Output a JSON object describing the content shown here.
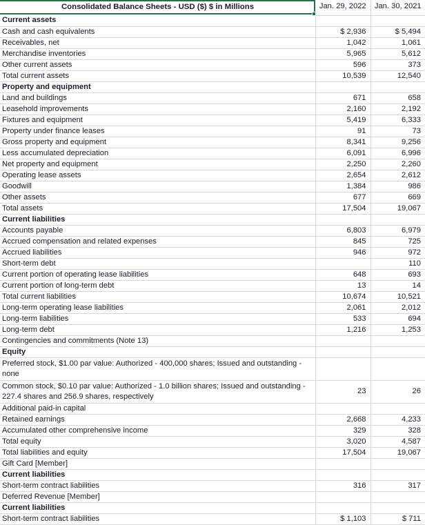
{
  "sheet": {
    "title": "Consolidated Balance Sheets - USD ($) $ in Millions",
    "columns": [
      "Jan. 29, 2022",
      "Jan. 30, 2021"
    ],
    "accent_color": "#217346",
    "gridline_color": "#d9d9d9",
    "text_color": "#1b1b2f"
  },
  "rows": [
    {
      "label": "Current assets",
      "bold": true,
      "tall": false,
      "v1": "",
      "v2": ""
    },
    {
      "label": "Cash and cash equivalents",
      "bold": false,
      "tall": false,
      "v1": "$ 2,936",
      "v2": "$ 5,494"
    },
    {
      "label": "Receivables, net",
      "bold": false,
      "tall": false,
      "v1": "1,042",
      "v2": "1,061"
    },
    {
      "label": "Merchandise inventories",
      "bold": false,
      "tall": false,
      "v1": "5,965",
      "v2": "5,612"
    },
    {
      "label": "Other current assets",
      "bold": false,
      "tall": false,
      "v1": "596",
      "v2": "373"
    },
    {
      "label": "Total current assets",
      "bold": false,
      "tall": false,
      "v1": "10,539",
      "v2": "12,540"
    },
    {
      "label": "Property and equipment",
      "bold": true,
      "tall": false,
      "v1": "",
      "v2": ""
    },
    {
      "label": "Land and buildings",
      "bold": false,
      "tall": false,
      "v1": "671",
      "v2": "658"
    },
    {
      "label": "Leasehold improvements",
      "bold": false,
      "tall": false,
      "v1": "2,160",
      "v2": "2,192"
    },
    {
      "label": "Fixtures and equipment",
      "bold": false,
      "tall": false,
      "v1": "5,419",
      "v2": "6,333"
    },
    {
      "label": "Property under finance leases",
      "bold": false,
      "tall": false,
      "v1": "91",
      "v2": "73"
    },
    {
      "label": "Gross property and equipment",
      "bold": false,
      "tall": false,
      "v1": "8,341",
      "v2": "9,256"
    },
    {
      "label": "Less accumulated depreciation",
      "bold": false,
      "tall": false,
      "v1": "6,091",
      "v2": "6,996"
    },
    {
      "label": "Net property and equipment",
      "bold": false,
      "tall": false,
      "v1": "2,250",
      "v2": "2,260"
    },
    {
      "label": "Operating lease assets",
      "bold": false,
      "tall": false,
      "v1": "2,654",
      "v2": "2,612"
    },
    {
      "label": "Goodwill",
      "bold": false,
      "tall": false,
      "v1": "1,384",
      "v2": "986"
    },
    {
      "label": "Other assets",
      "bold": false,
      "tall": false,
      "v1": "677",
      "v2": "669"
    },
    {
      "label": "Total assets",
      "bold": false,
      "tall": false,
      "v1": "17,504",
      "v2": "19,067"
    },
    {
      "label": "Current liabilities",
      "bold": true,
      "tall": false,
      "v1": "",
      "v2": ""
    },
    {
      "label": "Accounts payable",
      "bold": false,
      "tall": false,
      "v1": "6,803",
      "v2": "6,979"
    },
    {
      "label": "Accrued compensation and related expenses",
      "bold": false,
      "tall": false,
      "v1": "845",
      "v2": "725"
    },
    {
      "label": "Accrued liabilities",
      "bold": false,
      "tall": false,
      "v1": "946",
      "v2": "972"
    },
    {
      "label": "Short-term debt",
      "bold": false,
      "tall": false,
      "v1": "",
      "v2": "110"
    },
    {
      "label": "Current portion of operating lease liabilities",
      "bold": false,
      "tall": false,
      "v1": "648",
      "v2": "693"
    },
    {
      "label": "Current portion of long-term debt",
      "bold": false,
      "tall": false,
      "v1": "13",
      "v2": "14"
    },
    {
      "label": "Total current liabilities",
      "bold": false,
      "tall": false,
      "v1": "10,674",
      "v2": "10,521"
    },
    {
      "label": "Long-term operating lease liabilities",
      "bold": false,
      "tall": false,
      "v1": "2,061",
      "v2": "2,012"
    },
    {
      "label": "Long-term liabilities",
      "bold": false,
      "tall": false,
      "v1": "533",
      "v2": "694"
    },
    {
      "label": "Long-term debt",
      "bold": false,
      "tall": false,
      "v1": "1,216",
      "v2": "1,253"
    },
    {
      "label": "Contingencies and commitments (Note 13)",
      "bold": false,
      "tall": false,
      "v1": "",
      "v2": ""
    },
    {
      "label": "Equity",
      "bold": true,
      "tall": false,
      "v1": "",
      "v2": ""
    },
    {
      "label": "Preferred stock, $1.00 par value: Authorized - 400,000 shares; Issued and outstanding - none",
      "bold": false,
      "tall": true,
      "v1": "",
      "v2": ""
    },
    {
      "label": "Common stock, $0.10 par value: Authorized - 1.0 billion shares; Issued and outstanding - 227.4 shares and 256.9 shares, respectively",
      "bold": false,
      "tall": true,
      "v1": "23",
      "v2": "26"
    },
    {
      "label": "Additional paid-in capital",
      "bold": false,
      "tall": false,
      "v1": "",
      "v2": ""
    },
    {
      "label": "Retained earnings",
      "bold": false,
      "tall": false,
      "v1": "2,668",
      "v2": "4,233"
    },
    {
      "label": "Accumulated other comprehensive income",
      "bold": false,
      "tall": false,
      "v1": "329",
      "v2": "328"
    },
    {
      "label": "Total equity",
      "bold": false,
      "tall": false,
      "v1": "3,020",
      "v2": "4,587"
    },
    {
      "label": "Total liabilities and equity",
      "bold": false,
      "tall": false,
      "v1": "17,504",
      "v2": "19,067"
    },
    {
      "label": "Gift Card [Member]",
      "bold": false,
      "tall": false,
      "v1": "",
      "v2": ""
    },
    {
      "label": "Current liabilities",
      "bold": true,
      "tall": false,
      "v1": "",
      "v2": ""
    },
    {
      "label": "Short-term contract liabilities",
      "bold": false,
      "tall": false,
      "v1": "316",
      "v2": "317"
    },
    {
      "label": "Deferred Revenue [Member]",
      "bold": false,
      "tall": false,
      "v1": "",
      "v2": ""
    },
    {
      "label": "Current liabilities",
      "bold": true,
      "tall": false,
      "v1": "",
      "v2": ""
    },
    {
      "label": "Short-term contract liabilities",
      "bold": false,
      "tall": false,
      "v1": "$ 1,103",
      "v2": "$ 711"
    }
  ]
}
